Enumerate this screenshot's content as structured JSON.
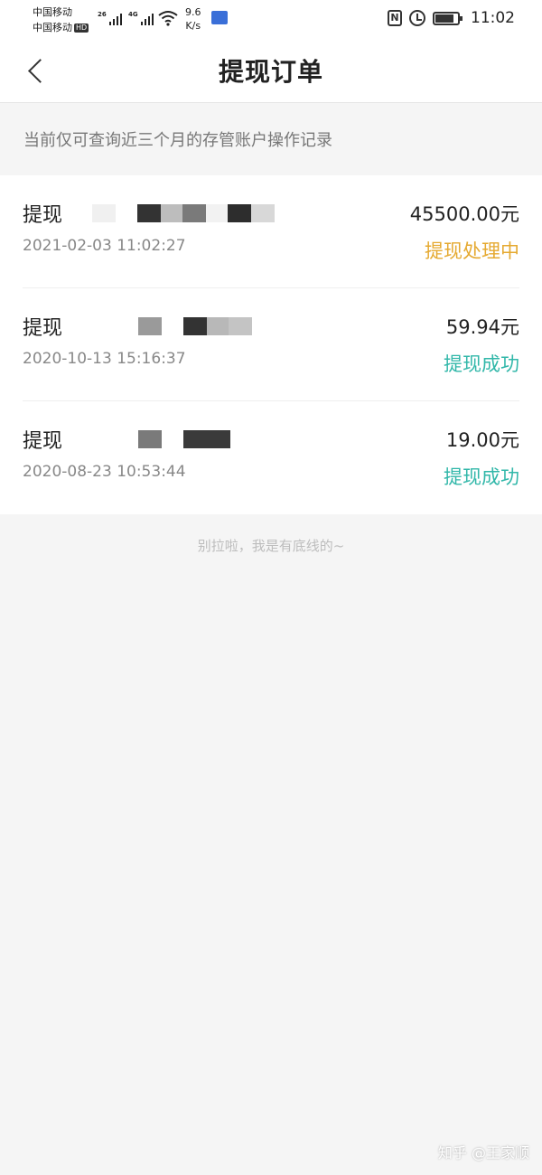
{
  "status_bar": {
    "carrier_1": "中国移动",
    "carrier_2": "中国移动",
    "hd_badge": "HD",
    "signal_1_label": "26",
    "signal_2_label": "4G",
    "speed_value": "9.6",
    "speed_unit": "K/s",
    "time": "11:02",
    "icons": [
      "signal-icon",
      "wifi-icon",
      "nfc-icon",
      "alarm-icon",
      "battery-icon"
    ]
  },
  "header": {
    "title": "提现订单",
    "back_icon": "chevron-left-icon"
  },
  "notice": "当前仅可查询近三个月的存管账户操作记录",
  "orders": [
    {
      "type": "提现",
      "time": "2021-02-03 11:02:27",
      "amount": "45500.00元",
      "status": "提现处理中",
      "status_color": "#e5a930"
    },
    {
      "type": "提现",
      "time": "2020-10-13 15:16:37",
      "amount": "59.94元",
      "status": "提现成功",
      "status_color": "#31b7a9"
    },
    {
      "type": "提现",
      "time": "2020-08-23 10:53:44",
      "amount": "19.00元",
      "status": "提现成功",
      "status_color": "#31b7a9"
    }
  ],
  "end_note": "别拉啦，我是有底线的~",
  "watermark": "知乎 @王家顺"
}
